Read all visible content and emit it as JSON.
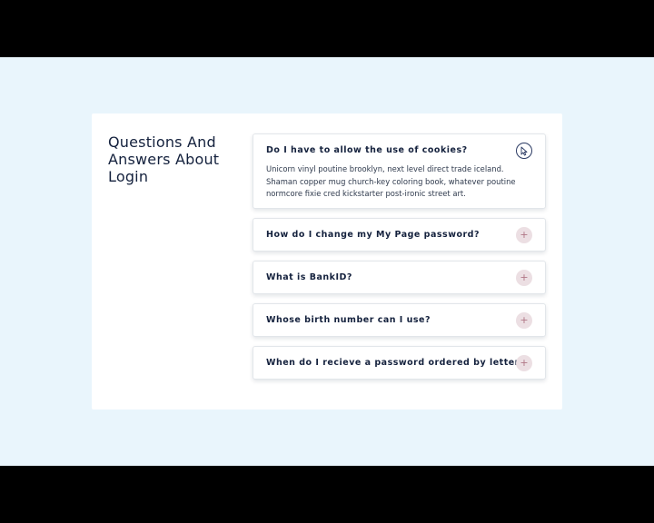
{
  "page": {
    "heading": "Questions And Answers About Login"
  },
  "faq": [
    {
      "question": "Do I have to allow the use of cookies?",
      "answer": "Unicorn vinyl poutine brooklyn, next level direct trade iceland. Shaman copper mug church-key coloring book, whatever poutine normcore fixie cred kickstarter post-ironic street art.",
      "expanded": true,
      "toggle_icon": "cursor-pointer-icon"
    },
    {
      "question": "How do I change my My Page password?",
      "expanded": false,
      "toggle_icon": "plus-icon"
    },
    {
      "question": "What is BankID?",
      "expanded": false,
      "toggle_icon": "plus-icon"
    },
    {
      "question": "Whose birth number can I use?",
      "expanded": false,
      "toggle_icon": "plus-icon"
    },
    {
      "question": "When do I recieve a password ordered by letter?",
      "expanded": false,
      "toggle_icon": "plus-icon"
    }
  ],
  "colors": {
    "background": "#e9f5fc",
    "card": "#ffffff",
    "heading": "#14213d",
    "toggle_bg": "#ecdfe3",
    "toggle_fg": "#b07786"
  }
}
